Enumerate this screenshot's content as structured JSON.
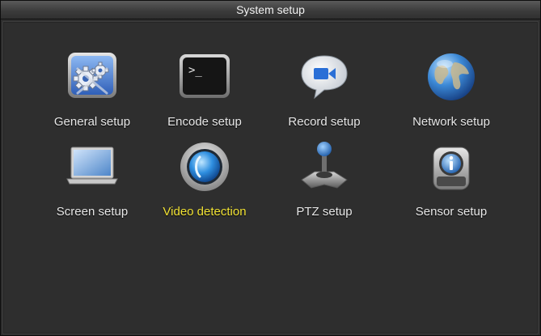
{
  "window": {
    "title": "System setup"
  },
  "menu": {
    "selected_index": 5,
    "items": [
      {
        "label": "General setup",
        "icon": "gear-icon"
      },
      {
        "label": "Encode setup",
        "icon": "terminal-icon"
      },
      {
        "label": "Record setup",
        "icon": "video-camera-icon"
      },
      {
        "label": "Network setup",
        "icon": "globe-icon"
      },
      {
        "label": "Screen setup",
        "icon": "laptop-icon"
      },
      {
        "label": "Video detection",
        "icon": "motion-detection-icon"
      },
      {
        "label": "PTZ setup",
        "icon": "joystick-icon"
      },
      {
        "label": "Sensor setup",
        "icon": "sensor-icon"
      }
    ]
  },
  "colors": {
    "selected_label": "#f2e334",
    "label": "#e8e8e8",
    "background": "#2e2e2e"
  }
}
